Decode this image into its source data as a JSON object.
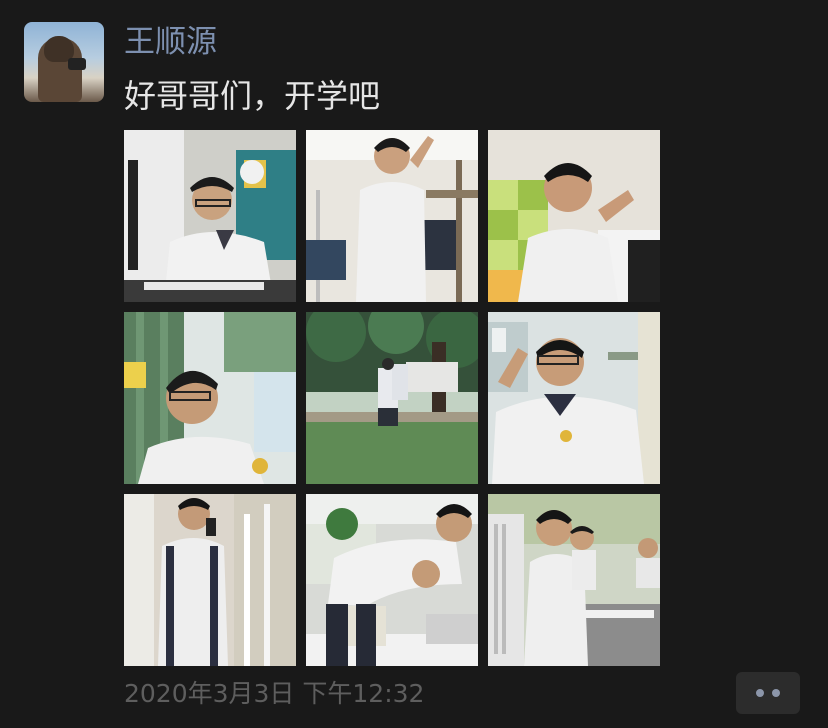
{
  "post": {
    "username": "王顺源",
    "caption": "好哥哥们，开学吧",
    "timestamp": "2020年3月3日 下午12:32"
  },
  "photos": [
    {
      "name": "photo-student-writing-at-desk"
    },
    {
      "name": "photo-student-in-dorm-bunk"
    },
    {
      "name": "photo-student-reclining-on-pillow"
    },
    {
      "name": "photo-student-by-curtain"
    },
    {
      "name": "photo-students-under-tree"
    },
    {
      "name": "photo-student-waving"
    },
    {
      "name": "photo-student-on-phone"
    },
    {
      "name": "photo-students-leaning-over-desk"
    },
    {
      "name": "photo-students-in-classroom"
    }
  ],
  "colors": {
    "background": "#191919",
    "username": "#7d90b0",
    "caption": "#e6e6e6",
    "timestamp": "#5e5e5e",
    "more_button": "#2c2c2c"
  },
  "icons": {
    "more_button": "more-dots-icon"
  }
}
